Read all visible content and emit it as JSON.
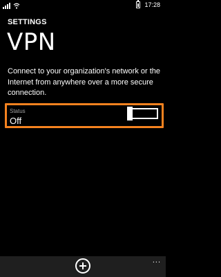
{
  "status_bar": {
    "time": "17:28",
    "icons": [
      "signal-icon",
      "wifi-icon",
      "battery-icon"
    ]
  },
  "header": {
    "section": "SETTINGS",
    "title": "VPN"
  },
  "description": "Connect to your organization's network or the Internet from anywhere over a more secure connection.",
  "status": {
    "label": "Status",
    "value": "Off",
    "toggle_on": false,
    "highlight_color": "#f5821f"
  },
  "app_bar": {
    "add_icon": "add-circle-icon",
    "more_label": "..."
  }
}
